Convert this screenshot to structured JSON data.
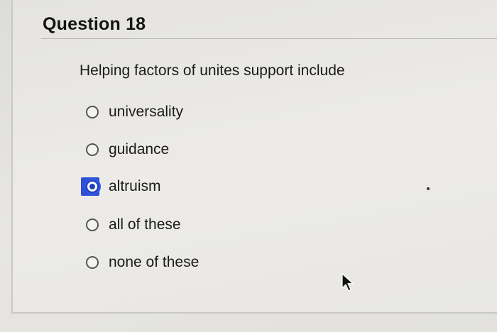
{
  "question": {
    "title": "Question 18",
    "prompt": "Helping factors of unites support include",
    "options": [
      {
        "label": "universality",
        "selected": false
      },
      {
        "label": "guidance",
        "selected": false
      },
      {
        "label": "altruism",
        "selected": true
      },
      {
        "label": "all of these",
        "selected": false
      },
      {
        "label": "none of these",
        "selected": false
      }
    ]
  },
  "colors": {
    "selected_accent": "#2f4fd6",
    "text": "#1b1b1b",
    "background": "#e8e7e3"
  },
  "icons": {
    "radio_unselected": "radio-empty-icon",
    "radio_selected": "radio-selected-icon",
    "pointer": "mouse-pointer-icon"
  }
}
